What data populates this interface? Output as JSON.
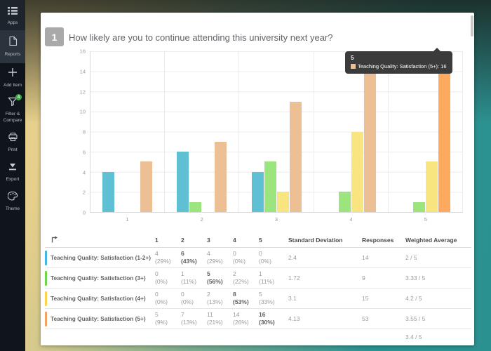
{
  "sidebar": {
    "items": [
      {
        "id": "apps",
        "icon": "apps-icon",
        "label": "Apps"
      },
      {
        "id": "reports",
        "icon": "reports-icon",
        "label": "Reports",
        "active": true
      },
      {
        "id": "add-item",
        "icon": "add-item-icon",
        "label": "Add Item"
      },
      {
        "id": "filter-compare",
        "icon": "filter-icon",
        "label": "Filter & Compare",
        "badge": "4"
      },
      {
        "id": "print",
        "icon": "print-icon",
        "label": "Print"
      },
      {
        "id": "export",
        "icon": "export-icon",
        "label": "Export"
      },
      {
        "id": "theme",
        "icon": "theme-icon",
        "label": "Theme"
      }
    ]
  },
  "question": {
    "number": "1",
    "text": "How likely are you to continue attending this university next year?"
  },
  "chart_data": {
    "type": "bar",
    "title": "",
    "xlabel": "",
    "ylabel": "",
    "categories": [
      "1",
      "2",
      "3",
      "4",
      "5"
    ],
    "series": [
      {
        "name": "Teaching Quality: Satisfaction (1-2+)",
        "color": "#5fc0d4",
        "values": [
          4,
          6,
          4,
          0,
          0
        ]
      },
      {
        "name": "Teaching Quality: Satisfaction (3+)",
        "color": "#9ce47e",
        "values": [
          0,
          1,
          5,
          2,
          1
        ]
      },
      {
        "name": "Teaching Quality: Satisfaction (4+)",
        "color": "#f9e57f",
        "values": [
          0,
          0,
          2,
          8,
          5
        ]
      },
      {
        "name": "Teaching Quality: Satisfaction (5+)",
        "color": "#edbf94",
        "values": [
          5,
          7,
          11,
          14,
          16
        ]
      }
    ],
    "highlight": {
      "series_index": 3,
      "category_index": 4,
      "color": "#fdaa60"
    },
    "ylim": [
      0,
      16
    ],
    "yticks": [
      0,
      2,
      4,
      6,
      8,
      10,
      12,
      14,
      16
    ],
    "grid": true,
    "legend_position": "none"
  },
  "tooltip": {
    "title": "5",
    "label": "Teaching Quality: Satisfaction (5+): 16",
    "swatch_color": "#edbf94"
  },
  "table": {
    "columns": [
      "1",
      "2",
      "3",
      "4",
      "5",
      "Standard Deviation",
      "Responses",
      "Weighted Average"
    ],
    "rows": [
      {
        "label": "Teaching Quality: Satisfaction (1-2+)",
        "accent": "#45b5e8",
        "bold_col": 1,
        "counts": [
          "4",
          "6",
          "4",
          "0",
          "0"
        ],
        "pcts": [
          "(29%)",
          "(43%)",
          "(29%)",
          "(0%)",
          "(0%)"
        ],
        "std": "2.4",
        "responses": "14",
        "weighted": "2 / 5"
      },
      {
        "label": "Teaching Quality: Satisfaction (3+)",
        "accent": "#6fd54e",
        "bold_col": 2,
        "counts": [
          "0",
          "1",
          "5",
          "2",
          "1"
        ],
        "pcts": [
          "(0%)",
          "(11%)",
          "(56%)",
          "(22%)",
          "(11%)"
        ],
        "std": "1.72",
        "responses": "9",
        "weighted": "3.33 / 5"
      },
      {
        "label": "Teaching Quality: Satisfaction (4+)",
        "accent": "#ffd24d",
        "bold_col": 3,
        "counts": [
          "0",
          "0",
          "2",
          "8",
          "5"
        ],
        "pcts": [
          "(0%)",
          "(0%)",
          "(13%)",
          "(53%)",
          "(33%)"
        ],
        "std": "3.1",
        "responses": "15",
        "weighted": "4.2 / 5"
      },
      {
        "label": "Teaching Quality: Satisfaction (5+)",
        "accent": "#f2a266",
        "bold_col": 4,
        "counts": [
          "5",
          "7",
          "11",
          "14",
          "16"
        ],
        "pcts": [
          "(9%)",
          "(13%)",
          "(21%)",
          "(26%)",
          "(30%)"
        ],
        "std": "4.13",
        "responses": "53",
        "weighted": "3.55 / 5"
      }
    ],
    "footer_weighted": "3.4 / 5"
  }
}
